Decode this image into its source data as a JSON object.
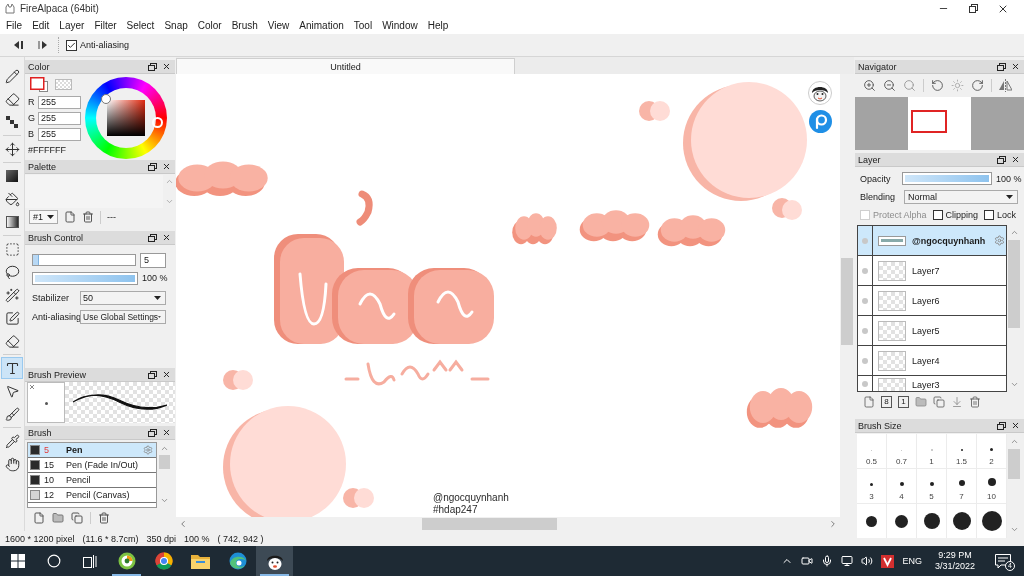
{
  "window": {
    "title": "FireAlpaca (64bit)"
  },
  "menu": [
    "File",
    "Edit",
    "Layer",
    "Filter",
    "Select",
    "Snap",
    "Color",
    "Brush",
    "View",
    "Animation",
    "Tool",
    "Window",
    "Help"
  ],
  "toolbar": {
    "anti_aliasing": {
      "label": "Anti-aliasing",
      "checked": true
    }
  },
  "tool_groups": [
    [
      {
        "kind": "pen",
        "selected": false
      },
      {
        "kind": "eraser",
        "selected": false
      },
      {
        "kind": "dots",
        "selected": false
      }
    ],
    [
      {
        "kind": "move",
        "selected": false
      }
    ],
    [
      {
        "kind": "fill",
        "selected": false
      },
      {
        "kind": "bucket",
        "selected": false
      },
      {
        "kind": "gradient",
        "selected": false
      }
    ],
    [
      {
        "kind": "select",
        "selected": false
      },
      {
        "kind": "lasso",
        "selected": false
      },
      {
        "kind": "wand",
        "selected": false
      },
      {
        "kind": "select_pen",
        "selected": false
      },
      {
        "kind": "select_eraser",
        "selected": false
      }
    ],
    [
      {
        "kind": "text",
        "selected": true
      },
      {
        "kind": "operation",
        "selected": false
      },
      {
        "kind": "smudge",
        "selected": false
      }
    ],
    [
      {
        "kind": "eyedropper",
        "selected": false
      },
      {
        "kind": "hand",
        "selected": false
      }
    ]
  ],
  "color_panel": {
    "title": "Color",
    "channels": [
      {
        "label": "R",
        "value": "255"
      },
      {
        "label": "G",
        "value": "255"
      },
      {
        "label": "B",
        "value": "255"
      }
    ],
    "hex": "#FFFFFF"
  },
  "palette_panel": {
    "title": "Palette",
    "set": "#1",
    "separator": "---"
  },
  "brush_control": {
    "title": "Brush Control",
    "size": {
      "value": "5",
      "level": 0.06
    },
    "opacity": {
      "reading": "100 %",
      "level": 1
    },
    "stabilizer": {
      "label": "Stabilizer",
      "value": "50"
    },
    "anti_aliasing": {
      "label": "Anti-aliasing",
      "value": "Use Global Settings"
    }
  },
  "brush_preview": {
    "title": "Brush Preview"
  },
  "brush_panel": {
    "title": "Brush",
    "items": [
      {
        "size": "5",
        "name": "Pen",
        "selected": true,
        "color": "#2b2b2b"
      },
      {
        "size": "15",
        "name": "Pen (Fade In/Out)",
        "selected": false,
        "color": "#2b2b2b"
      },
      {
        "size": "10",
        "name": "Pencil",
        "selected": false,
        "color": "#2b2b2b"
      },
      {
        "size": "12",
        "name": "Pencil (Canvas)",
        "selected": false,
        "color": "#d4d4d4"
      }
    ]
  },
  "canvas": {
    "tab": "Untitled",
    "texts": [
      "@ngocquynhanh",
      "#hdap247"
    ]
  },
  "navigator": {
    "title": "Navigator"
  },
  "layer_panel": {
    "title": "Layer",
    "opacity": {
      "label": "Opacity",
      "reading": "100 %",
      "level": 1
    },
    "blending": {
      "label": "Blending",
      "value": "Normal"
    },
    "options": [
      {
        "label": "Protect Alpha",
        "checked": false,
        "disabled": true
      },
      {
        "label": "Clipping",
        "checked": false,
        "disabled": false
      },
      {
        "label": "Lock",
        "checked": false,
        "disabled": false
      }
    ],
    "layers": [
      {
        "name": "@ngocquynhanh",
        "kind": "text",
        "selected": true
      },
      {
        "name": "Layer7",
        "kind": "raster",
        "selected": false
      },
      {
        "name": "Layer6",
        "kind": "raster",
        "selected": false
      },
      {
        "name": "Layer5",
        "kind": "raster",
        "selected": false
      },
      {
        "name": "Layer4",
        "kind": "raster",
        "selected": false
      },
      {
        "name": "Layer3",
        "kind": "raster",
        "selected": false
      }
    ],
    "actions": [
      {
        "kind": "new"
      },
      {
        "kind": "depth",
        "label": "8"
      },
      {
        "kind": "depth",
        "label": "1"
      },
      {
        "kind": "folder"
      },
      {
        "kind": "duplicate"
      },
      {
        "kind": "merge"
      },
      {
        "kind": "delete"
      }
    ]
  },
  "brush_size": {
    "title": "Brush Size",
    "sizes": [
      "0.5",
      "0.7",
      "1",
      "1.5",
      "2",
      "3",
      "4",
      "5",
      "7",
      "10"
    ]
  },
  "status_bar": [
    "1600 * 1200 pixel",
    "(11.6 * 8.7cm)",
    "350 dpi",
    "100 %",
    "( 742, 942 )"
  ],
  "taskbar": {
    "apps": [
      {
        "kind": "swirl",
        "running": true,
        "selected": false
      },
      {
        "kind": "chrome",
        "running": false,
        "selected": false
      },
      {
        "kind": "explorer",
        "running": false,
        "selected": false
      },
      {
        "kind": "edge",
        "running": false,
        "selected": false
      },
      {
        "kind": "alpaca",
        "running": true,
        "selected": true
      }
    ],
    "language": "ENG",
    "time": "9:29 PM",
    "date": "3/31/2022",
    "notifications": "4"
  }
}
